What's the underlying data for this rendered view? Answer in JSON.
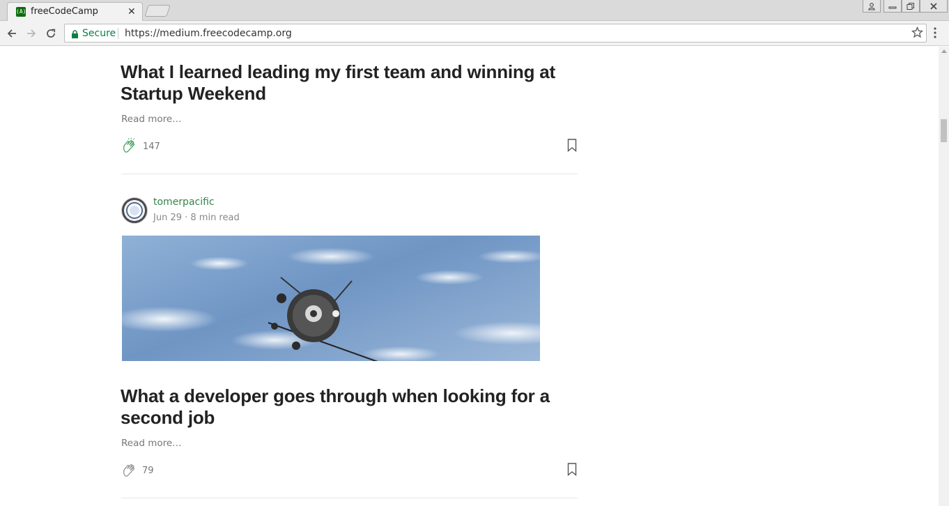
{
  "browser": {
    "tab_title": "freeCodeCamp",
    "tab_close": "✕",
    "favicon_text": "(A)",
    "secure_label": "Secure",
    "url": "https://medium.freecodecamp.org"
  },
  "articles": [
    {
      "title": "What I learned leading my first team and winning at Startup Weekend",
      "read_more": "Read more…",
      "claps": "147"
    },
    {
      "author": "tomerpacific",
      "date": "Jun 29",
      "read_time": "8 min read",
      "meta": "Jun 29 · 8 min read",
      "title": "What a developer goes through when looking for a second job",
      "read_more": "Read more…",
      "claps": "79"
    }
  ],
  "colors": {
    "secure_green": "#0b8043",
    "author_green": "#34834b",
    "text": "#222222",
    "muted": "#777777"
  },
  "icons": [
    "back-arrow-icon",
    "forward-arrow-icon",
    "reload-icon",
    "lock-icon",
    "star-icon",
    "menu-dots-icon",
    "clap-icon",
    "bookmark-icon",
    "profile-icon",
    "minimize-icon",
    "restore-icon",
    "close-icon"
  ]
}
